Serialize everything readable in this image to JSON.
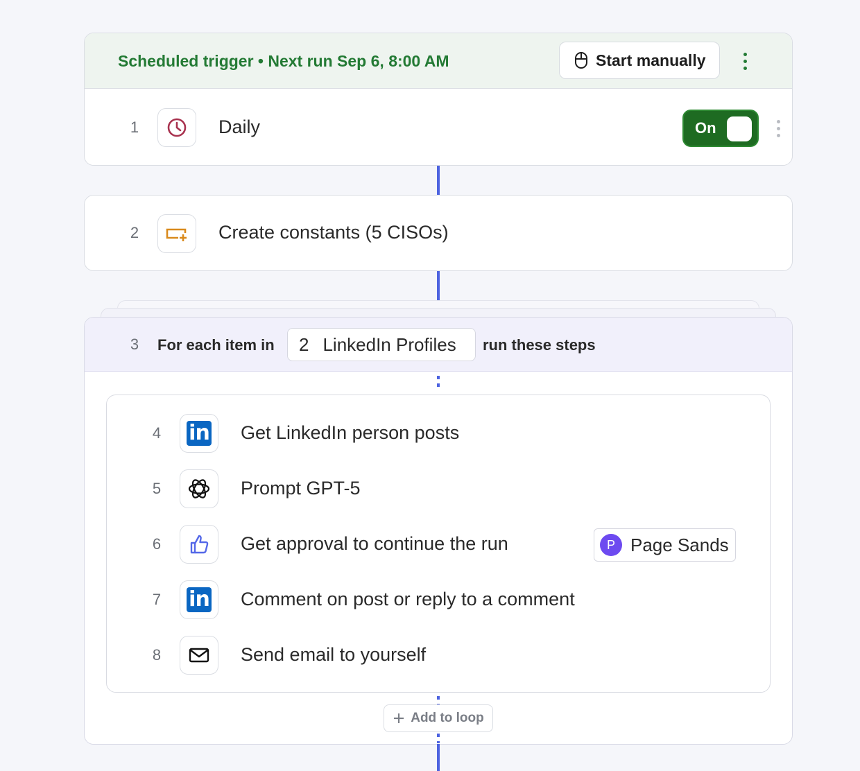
{
  "trigger": {
    "summary": "Scheduled trigger • Next run Sep 6, 8:00 AM",
    "start_label": "Start manually",
    "schedule": {
      "number": "1",
      "label": "Daily",
      "toggle_label": "On"
    }
  },
  "step2": {
    "number": "2",
    "label": "Create constants (5 CISOs)"
  },
  "loop": {
    "number": "3",
    "prefix": "For each item in",
    "source_number": "2",
    "source_label": "LinkedIn Profiles",
    "suffix": "run these steps",
    "steps": [
      {
        "number": "4",
        "label": "Get LinkedIn person posts",
        "icon": "linkedin-icon"
      },
      {
        "number": "5",
        "label": "Prompt GPT-5",
        "icon": "openai-icon"
      },
      {
        "number": "6",
        "label": "Get approval to continue the run",
        "icon": "thumbs-up-icon",
        "assignee": {
          "initial": "P",
          "name": "Page Sands"
        }
      },
      {
        "number": "7",
        "label": "Comment on post or reply to a comment",
        "icon": "linkedin-icon"
      },
      {
        "number": "8",
        "label": "Send email to yourself",
        "icon": "mail-icon"
      }
    ],
    "add_label": "Add to loop"
  },
  "colors": {
    "accent": "#4d63e0",
    "trigger_green": "#237a34",
    "toggle_on": "#1e6b22",
    "linkedin": "#0a66c2",
    "avatar": "#6d4af0"
  }
}
